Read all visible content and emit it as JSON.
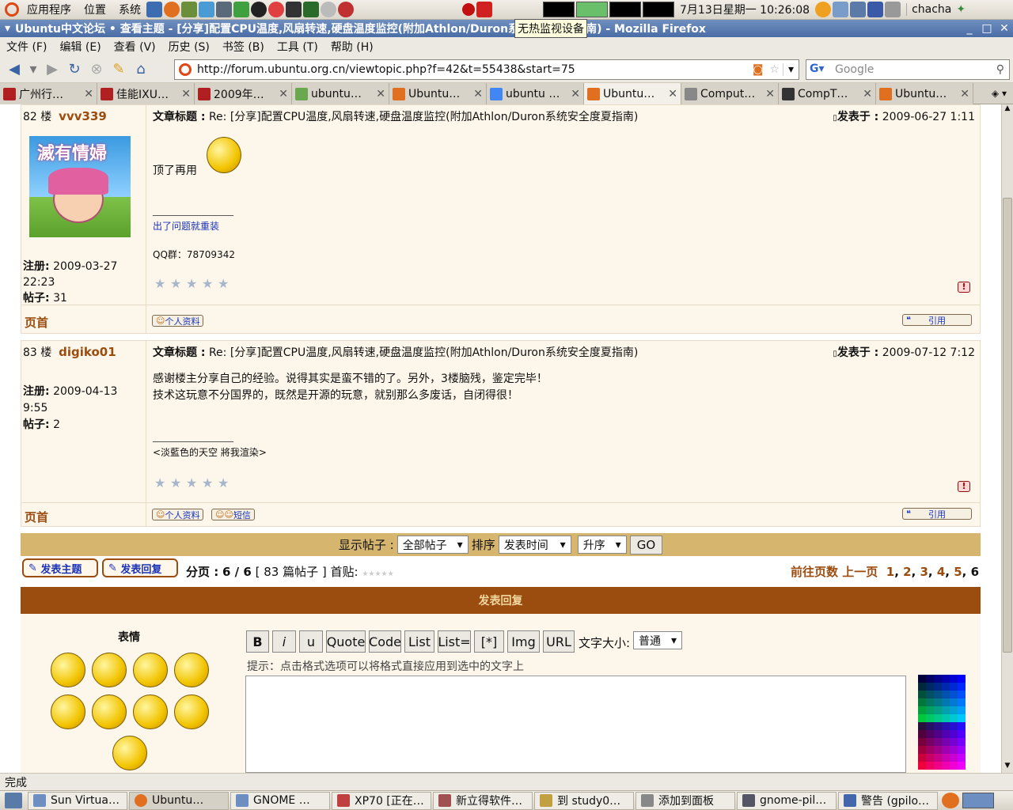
{
  "panel": {
    "menus": [
      "应用程序",
      "位置",
      "系统"
    ],
    "tooltip": "无热监视设备",
    "clock": "7月13日星期一 10:26:08",
    "user": "chacha"
  },
  "window": {
    "title": "Ubuntu中文论坛 • 查看主题 - [分享]配置CPU温度,风扇转速,硬盘温度监控(附加Athlon/Duron系统安全度夏指南) - Mozilla Firefox"
  },
  "menubar": [
    "文件 (F)",
    "编辑 (E)",
    "查看 (V)",
    "历史 (S)",
    "书签 (B)",
    "工具 (T)",
    "帮助 (H)"
  ],
  "nav": {
    "url": "http://forum.ubuntu.org.cn/viewtopic.php?f=42&t=55438&start=75",
    "search_placeholder": "Google"
  },
  "tabs": [
    {
      "label": "广州行…",
      "icon_color": "#b02020"
    },
    {
      "label": "佳能IXU…",
      "icon_color": "#b02020"
    },
    {
      "label": "2009年…",
      "icon_color": "#b02020"
    },
    {
      "label": "ubuntu…",
      "icon_color": "#6aa84f"
    },
    {
      "label": "Ubuntu…",
      "icon_color": "#e07020"
    },
    {
      "label": "ubuntu …",
      "icon_color": "#4285f4"
    },
    {
      "label": "Ubuntu…",
      "icon_color": "#e07020"
    },
    {
      "label": "Comput…",
      "icon_color": "#888888"
    },
    {
      "label": "CompT…",
      "icon_color": "#333333"
    },
    {
      "label": "Ubuntu…",
      "icon_color": "#e07020"
    }
  ],
  "labels": {
    "subject": "文章标题 :",
    "posted": "发表于 :",
    "reg": "注册:",
    "posts": "帖子:",
    "top": "页首",
    "profile": "个人资料",
    "pm": "短信",
    "quote": "引用"
  },
  "posts": [
    {
      "floor": "82 楼",
      "user": "vvv339",
      "avatar_text": "滅有情婦",
      "subject": "Re: [分享]配置CPU温度,风扇转速,硬盘温度监控(附加Athlon/Duron系统安全度夏指南)",
      "date": "2009-06-27 1:11",
      "body": [
        "顶了再用"
      ],
      "sig_line": "_________________",
      "sig": [
        "出了问题就重装",
        "QQ群：78709342"
      ],
      "reg_date": "2009-03-27 22:23",
      "post_count": "31"
    },
    {
      "floor": "83 楼",
      "user": "digiko01",
      "subject": "Re: [分享]配置CPU温度,风扇转速,硬盘温度监控(附加Athlon/Duron系统安全度夏指南)",
      "date": "2009-07-12 7:12",
      "body": [
        "感谢楼主分享自己的经验。说得其实是蛮不错的了。另外，3楼脑残，鉴定完毕！",
        "技术这玩意不分国界的，既然是开源的玩意，就别那么多废话，自闭得很！"
      ],
      "sig_line": "_________________",
      "sig": [
        "<淡藍色的天空 將我渲染>"
      ],
      "reg_date": "2009-04-13 9:55",
      "post_count": "2"
    }
  ],
  "sortbar": {
    "show_label": "显示帖子 :",
    "show_value": "全部帖子",
    "sort_label": "排序",
    "sort_value": "发表时间",
    "order_value": "升序",
    "go": "GO"
  },
  "pagination": {
    "new_topic": "发表主题",
    "reply": "发表回复",
    "pages_label": "分页 :",
    "pages": "6 / 6",
    "count": "[ 83 篇帖子 ]",
    "first": "首贴:",
    "goto": "前往页数",
    "prev": "上一页",
    "page_links": [
      "1",
      "2",
      "3",
      "4",
      "5"
    ],
    "current": "6"
  },
  "reply": {
    "header": "发表回复",
    "smilies_label": "表情",
    "buttons": [
      "B",
      "i",
      "u",
      "Quote",
      "Code",
      "List",
      "List=",
      "[*]",
      "Img",
      "URL"
    ],
    "size_label": "文字大小:",
    "size_value": "普通",
    "hint": "提示：点击格式选项可以将格式直接应用到选中的文字上"
  },
  "status": "完成",
  "tasks": [
    "Sun Virtua…",
    "Ubuntu…",
    "GNOME …",
    "XP70 [正在…",
    "新立得软件…",
    "到 study0…",
    "添加到面板",
    "gnome-pil…",
    "警告 (gpilo…"
  ]
}
